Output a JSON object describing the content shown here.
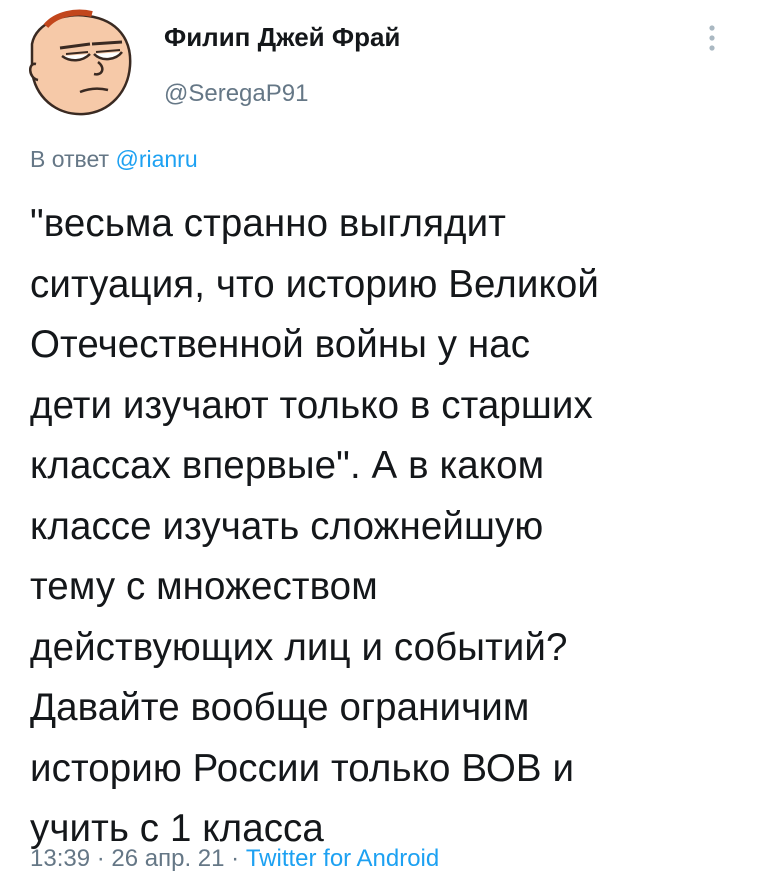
{
  "user": {
    "display_name": "Филип Джей Фрай",
    "handle": "@SeregaP91",
    "avatar_icon": "fry-squint-avatar-icon"
  },
  "menu": {
    "icon": "vertical-dots-more-icon"
  },
  "reply": {
    "prefix": "В ответ ",
    "mention": "@rianru"
  },
  "tweet": {
    "text": "\"весьма странно выглядит\nситуация, что историю Великой\nОтечественной войны у нас\nдети изучают только в старших\nклассах впервые\". А в каком\nклассе изучать сложнейшую\nтему с множеством\nдействующих лиц и событий?\nДавайте вообще ограничим\nисторию России только ВОВ и\nучить с 1 класса"
  },
  "meta": {
    "time": "13:39",
    "sep1": " · ",
    "date": "26 апр. 21",
    "sep2": " · ",
    "source": "Twitter for Android"
  },
  "colors": {
    "link": "#1da1f2",
    "secondary_text": "#657786",
    "primary_text": "#14171a",
    "avatar_skin": "#f6c9a8"
  }
}
